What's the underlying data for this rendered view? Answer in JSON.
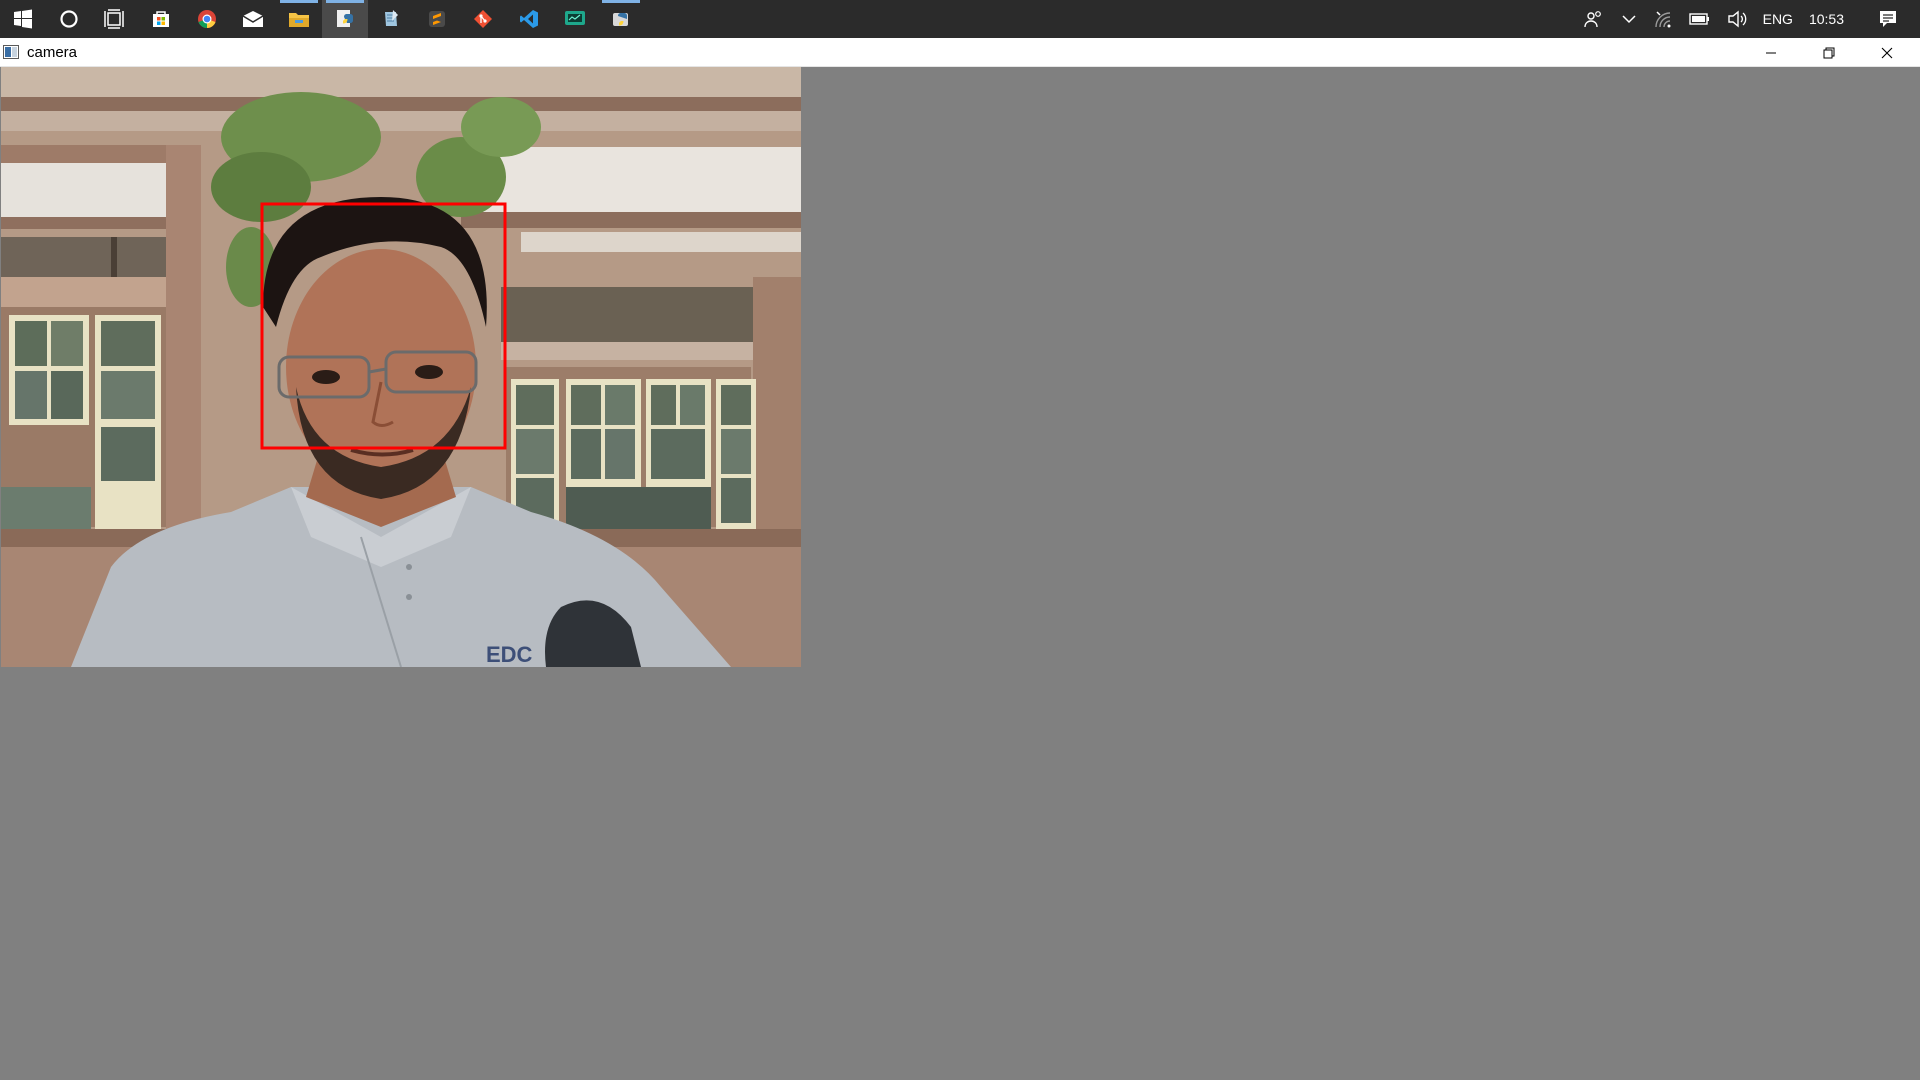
{
  "taskbar": {
    "apps": [
      {
        "icon": "windows-start-icon",
        "running": false,
        "active": false
      },
      {
        "icon": "cortana-icon",
        "running": false,
        "active": false
      },
      {
        "icon": "task-view-icon",
        "running": false,
        "active": false
      },
      {
        "icon": "store-icon",
        "running": false,
        "active": false
      },
      {
        "icon": "chrome-icon",
        "running": false,
        "active": false
      },
      {
        "icon": "mail-icon",
        "running": false,
        "active": false
      },
      {
        "icon": "file-explorer-icon",
        "running": true,
        "active": false
      },
      {
        "icon": "python-idle-icon",
        "running": true,
        "active": true
      },
      {
        "icon": "notepad-icon",
        "running": false,
        "active": false
      },
      {
        "icon": "sublime-text-icon",
        "running": false,
        "active": false
      },
      {
        "icon": "git-icon",
        "running": false,
        "active": false
      },
      {
        "icon": "vscode-icon",
        "running": false,
        "active": false
      },
      {
        "icon": "monitor-app-icon",
        "running": false,
        "active": false
      },
      {
        "icon": "python-shell-icon",
        "running": true,
        "active": false
      }
    ],
    "tray": {
      "language": "ENG",
      "time": "10:53",
      "icons": [
        "people-icon",
        "chevron-up-icon",
        "wifi-icon",
        "battery-icon",
        "volume-icon",
        "action-center-icon"
      ]
    }
  },
  "window": {
    "title": "camera",
    "controls": [
      "minimize-icon",
      "restore-icon",
      "close-icon"
    ]
  },
  "camera": {
    "detection_box_color": "#ff0000",
    "shirt_text": "EDC"
  },
  "colors": {
    "taskbar_bg": "#2b2b2b",
    "client_bg": "#808080",
    "running_indicator": "#7fb2e5"
  }
}
